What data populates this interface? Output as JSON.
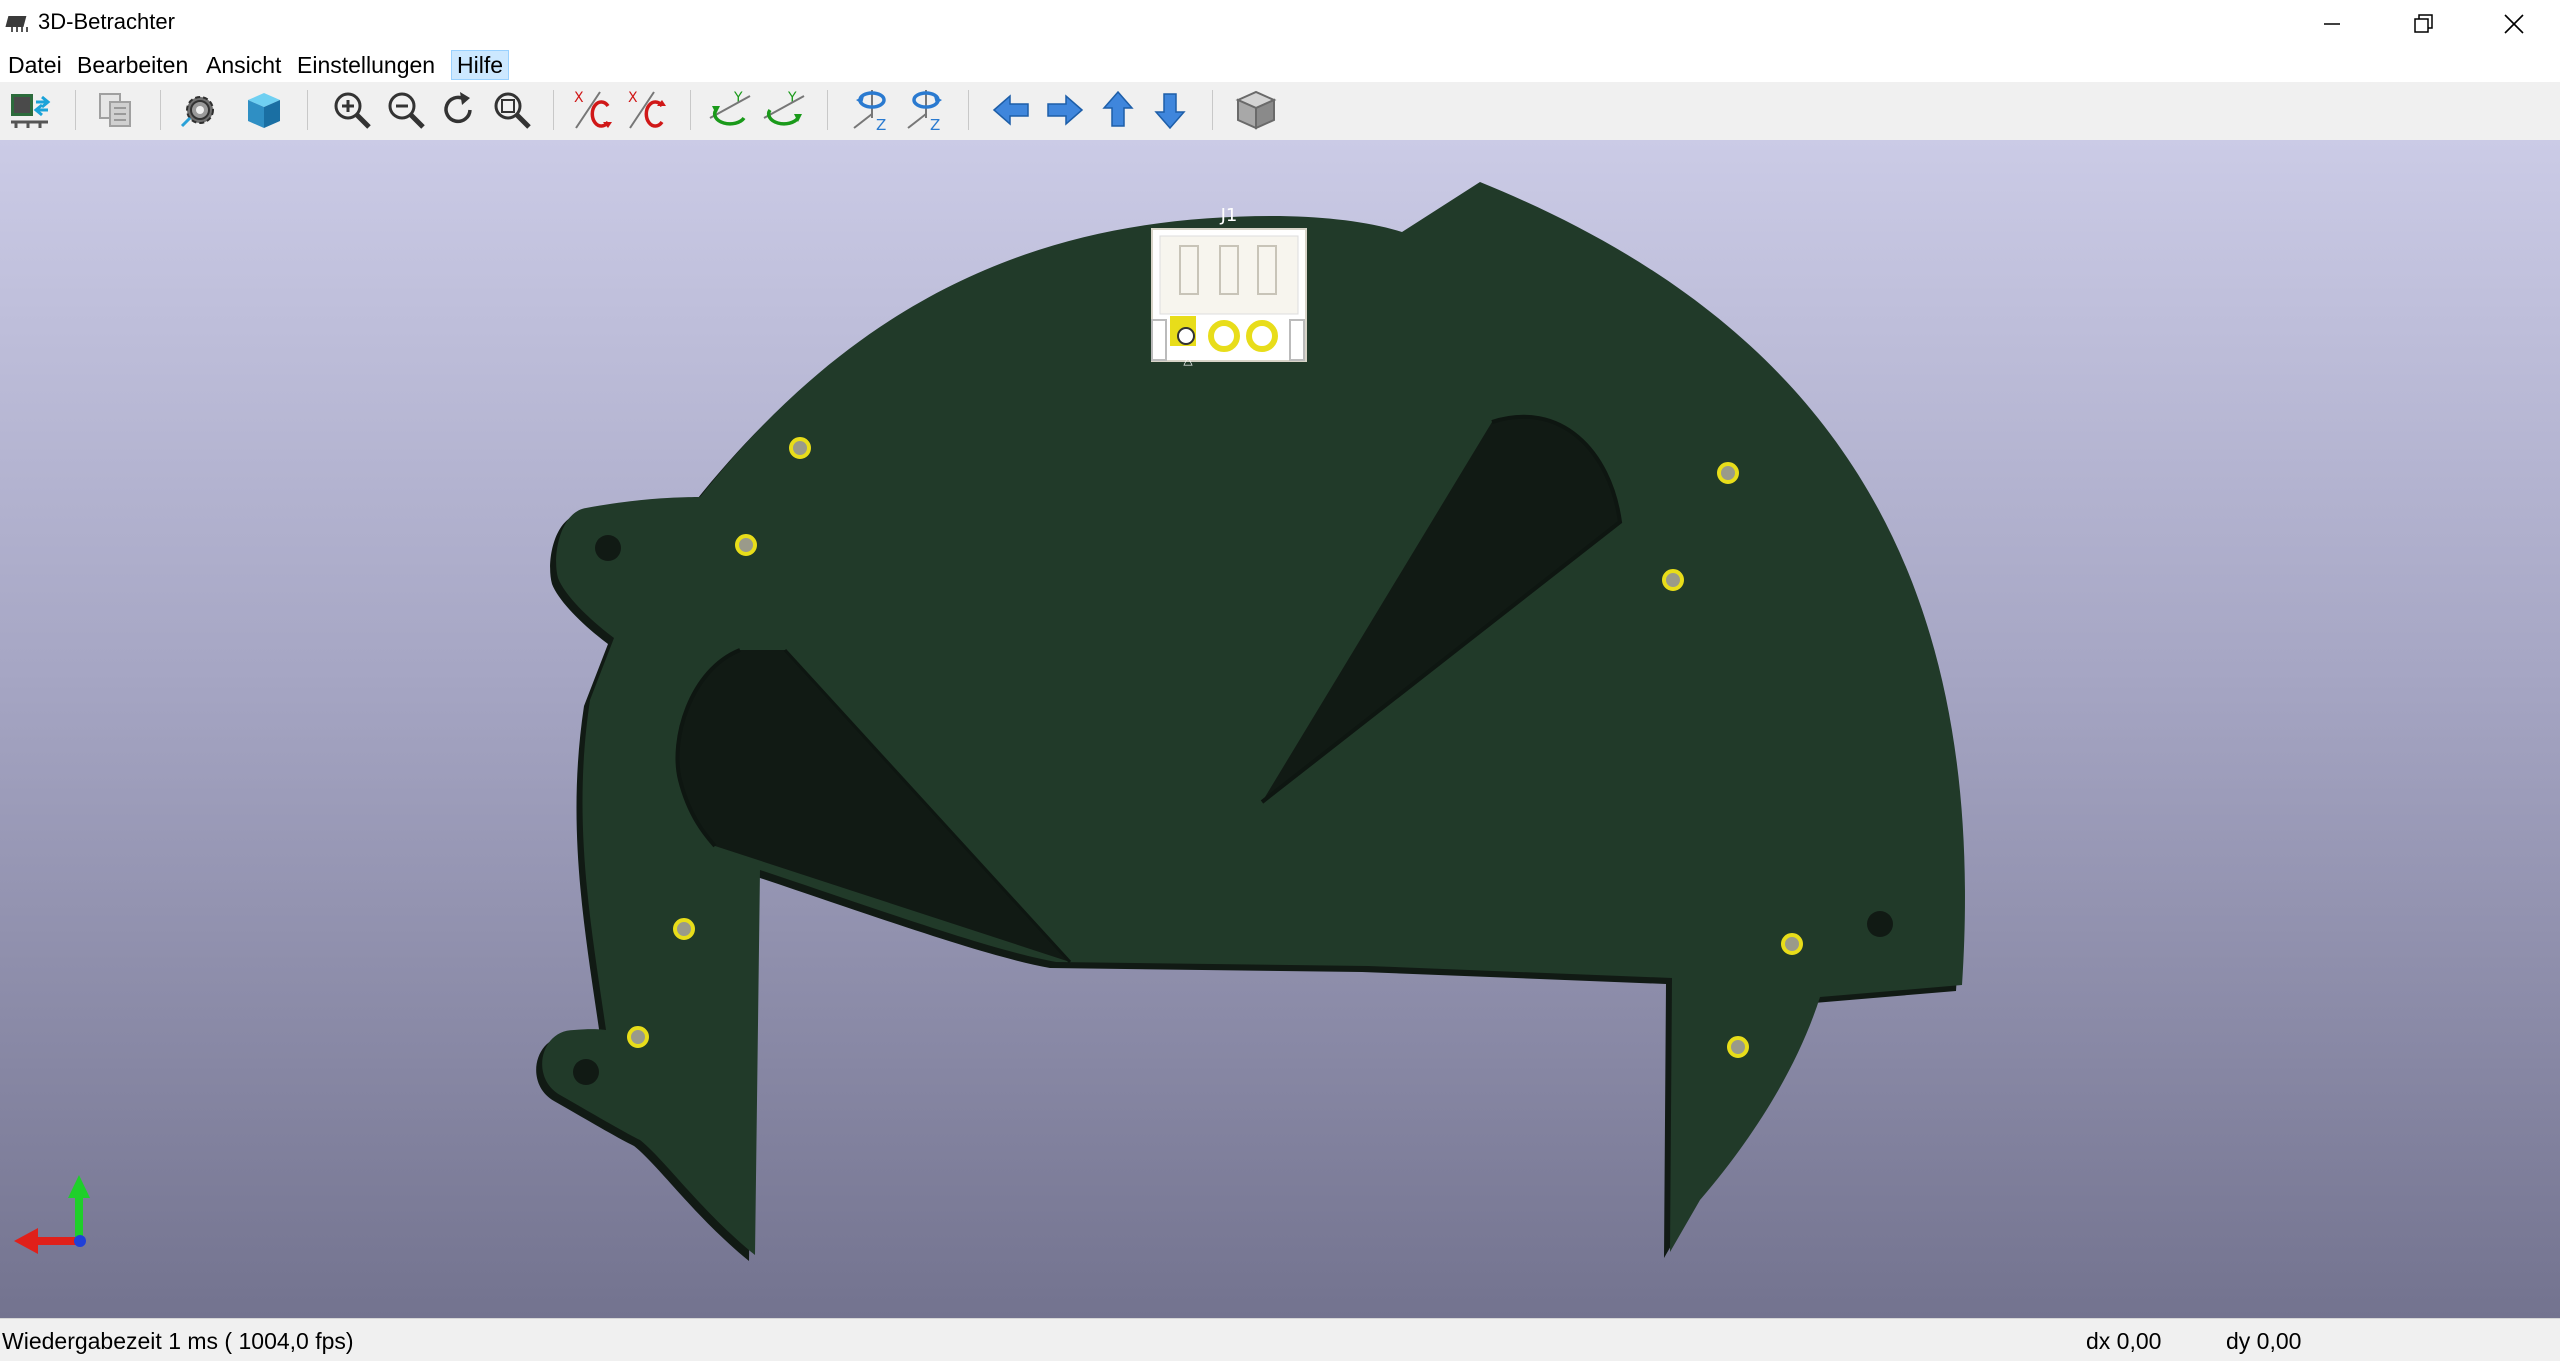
{
  "window": {
    "title": "3D-Betrachter",
    "icon": "chip-icon"
  },
  "menu": {
    "items": [
      "Datei",
      "Bearbeiten",
      "Ansicht",
      "Einstellungen",
      "Hilfe"
    ],
    "active": "Hilfe"
  },
  "toolbar": {
    "icons": [
      "reload-board-icon",
      "copy-image-icon",
      "settings-gear-icon",
      "render-mode-cube-icon",
      "zoom-in-icon",
      "zoom-out-icon",
      "redraw-icon",
      "zoom-fit-icon",
      "rotate-x-cw-icon",
      "rotate-x-ccw-icon",
      "rotate-y-cw-icon",
      "rotate-y-ccw-icon",
      "rotate-z-cw-icon",
      "rotate-z-ccw-icon",
      "pan-left-icon",
      "pan-right-icon",
      "pan-up-icon",
      "pan-down-icon",
      "orthographic-view-icon"
    ]
  },
  "board": {
    "reference": "J1",
    "pin1_marker": "△",
    "colors": {
      "board": "#213a29",
      "pad": "#e8dd1a",
      "connector": "#f7f5ee",
      "background_top": "#cbcbe6",
      "background_bottom": "#73738f"
    }
  },
  "axes": {
    "x_color": "#e0201a",
    "y_color": "#1fcf2a",
    "z_color": "#2040d8"
  },
  "status": {
    "render_time": "Wiedergabezeit 1 ms ( 1004,0 fps)",
    "dx": "dx 0,00",
    "dy": "dy 0,00"
  }
}
